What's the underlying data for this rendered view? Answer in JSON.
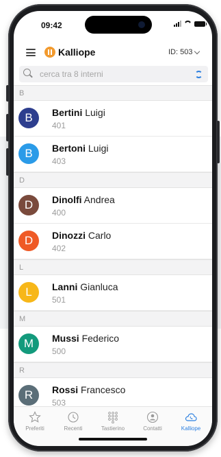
{
  "status": {
    "time": "09:42"
  },
  "header": {
    "app_title": "Kalliope",
    "id_label": "ID: 503"
  },
  "search": {
    "placeholder": "cerca tra 8 interni"
  },
  "colors": {
    "accent": "#2b7fe0",
    "logo": "#f29a2e"
  },
  "contacts": {
    "sections": [
      {
        "letter": "B"
      },
      {
        "letter": "D"
      },
      {
        "letter": "L"
      },
      {
        "letter": "M"
      },
      {
        "letter": "R"
      }
    ],
    "items": [
      {
        "initial": "B",
        "surname": "Bertini",
        "first": "Luigi",
        "ext": "401",
        "color": "#2d3e8e"
      },
      {
        "initial": "B",
        "surname": "Bertoni",
        "first": "Luigi",
        "ext": "403",
        "color": "#2b9be8"
      },
      {
        "initial": "D",
        "surname": "Dinolfi",
        "first": "Andrea",
        "ext": "400",
        "color": "#7a4a3c"
      },
      {
        "initial": "D",
        "surname": "Dinozzi",
        "first": "Carlo",
        "ext": "402",
        "color": "#ef5a26"
      },
      {
        "initial": "L",
        "surname": "Lanni",
        "first": "Gianluca",
        "ext": "501",
        "color": "#f7b719"
      },
      {
        "initial": "M",
        "surname": "Mussi",
        "first": "Federico",
        "ext": "500",
        "color": "#139a7c"
      },
      {
        "initial": "R",
        "surname": "Rossi",
        "first": "Francesco",
        "ext": "503",
        "color": "#5b6e78"
      }
    ]
  },
  "tabs": [
    {
      "label": "Preferiti",
      "icon": "star-icon"
    },
    {
      "label": "Recenti",
      "icon": "clock-icon"
    },
    {
      "label": "Tastierino",
      "icon": "keypad-icon"
    },
    {
      "label": "Contatti",
      "icon": "contact-icon"
    },
    {
      "label": "Kalliope",
      "icon": "cloud-phone-icon"
    }
  ]
}
